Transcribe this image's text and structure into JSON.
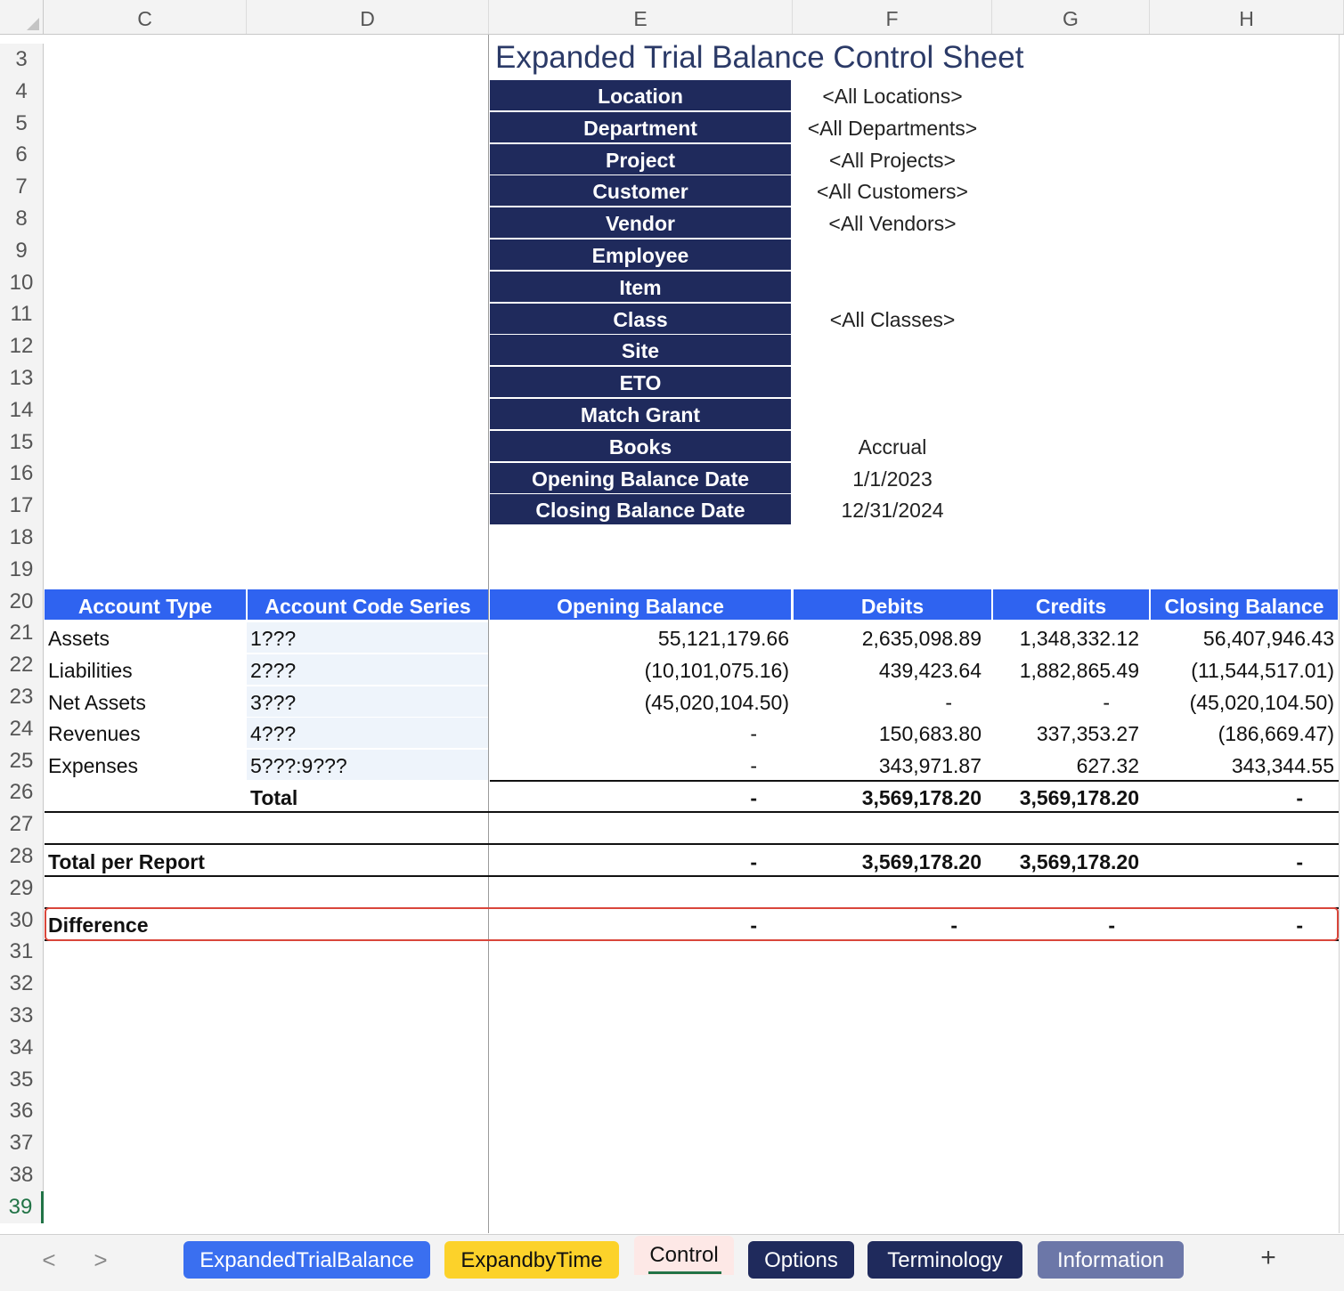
{
  "columns": [
    "C",
    "D",
    "E",
    "F",
    "G",
    "H"
  ],
  "rows": [
    "3",
    "4",
    "5",
    "6",
    "7",
    "8",
    "9",
    "10",
    "11",
    "12",
    "13",
    "14",
    "15",
    "16",
    "17",
    "18",
    "19",
    "20",
    "21",
    "22",
    "23",
    "24",
    "25",
    "26",
    "27",
    "28",
    "29",
    "30",
    "31",
    "32",
    "33",
    "34",
    "35",
    "36",
    "37",
    "38",
    "39"
  ],
  "title": "Expanded Trial Balance Control Sheet",
  "parameters": [
    {
      "label": "Location",
      "value": "<All Locations>"
    },
    {
      "label": "Department",
      "value": "<All Departments>"
    },
    {
      "label": "Project",
      "value": "<All Projects>"
    },
    {
      "label": "Customer",
      "value": "<All Customers>"
    },
    {
      "label": "Vendor",
      "value": "<All Vendors>"
    },
    {
      "label": "Employee",
      "value": ""
    },
    {
      "label": "Item",
      "value": ""
    },
    {
      "label": "Class",
      "value": "<All Classes>"
    },
    {
      "label": "Site",
      "value": ""
    },
    {
      "label": "ETO",
      "value": ""
    },
    {
      "label": "Match Grant",
      "value": ""
    },
    {
      "label": "Books",
      "value": "Accrual"
    },
    {
      "label": "Opening Balance Date",
      "value": "1/1/2023"
    },
    {
      "label": "Closing Balance Date",
      "value": "12/31/2024"
    }
  ],
  "table": {
    "headers": [
      "Account Type",
      "Account Code Series",
      "Opening Balance",
      "Debits",
      "Credits",
      "Closing Balance"
    ],
    "rows": [
      [
        "Assets",
        "1???",
        "55,121,179.66",
        "2,635,098.89",
        "1,348,332.12",
        "56,407,946.43"
      ],
      [
        "Liabilities",
        "2???",
        "(10,101,075.16)",
        "439,423.64",
        "1,882,865.49",
        "(11,544,517.01)"
      ],
      [
        "Net Assets",
        "3???",
        "(45,020,104.50)",
        "-",
        "-",
        "(45,020,104.50)"
      ],
      [
        "Revenues",
        "4???",
        "-",
        "150,683.80",
        "337,353.27",
        "(186,669.47)"
      ],
      [
        "Expenses",
        "5???:9???",
        "-",
        "343,971.87",
        "627.32",
        "343,344.55"
      ]
    ],
    "total": {
      "label": "Total",
      "values": [
        "-",
        "3,569,178.20",
        "3,569,178.20",
        "-"
      ]
    },
    "report_total": {
      "label": "Total per Report",
      "values": [
        "-",
        "3,569,178.20",
        "3,569,178.20",
        "-"
      ]
    },
    "difference": {
      "label": "Difference",
      "values": [
        "-",
        "-",
        "-",
        "-"
      ]
    }
  },
  "tabs": [
    {
      "label": "ExpandedTrialBalance",
      "bg": "#3a6ff0",
      "fg": "#ffffff"
    },
    {
      "label": "ExpandbyTime",
      "bg": "#fcd22a",
      "fg": "#111111"
    },
    {
      "label": "Control",
      "bg": "#fde8e6",
      "fg": "#111111",
      "active": true
    },
    {
      "label": "Options",
      "bg": "#1f2a5c",
      "fg": "#ffffff"
    },
    {
      "label": "Terminology",
      "bg": "#1f2a5c",
      "fg": "#ffffff"
    },
    {
      "label": "Information",
      "bg": "#6c77a8",
      "fg": "#ffffff"
    }
  ],
  "tab_nav": {
    "prev": "<",
    "next": ">",
    "add": "+"
  },
  "colors": {
    "header_blue": "#2f63f0",
    "label_navy": "#1f2a5c",
    "highlight_red": "#d9463b"
  }
}
